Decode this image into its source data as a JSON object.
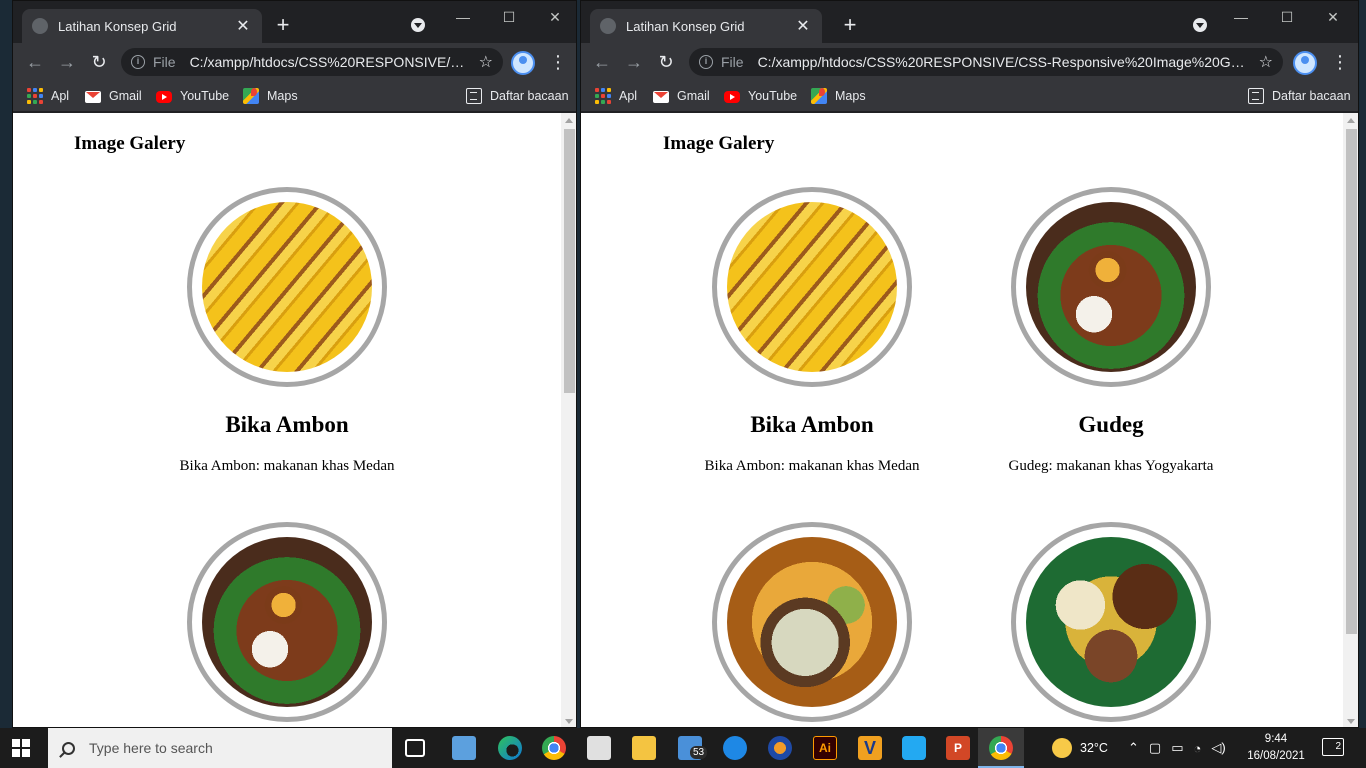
{
  "browser": {
    "tab_title": "Latihan Konsep Grid",
    "tab_close": "✕",
    "new_tab": "+",
    "scheme_label": "File",
    "window_controls": {
      "minimize": "—",
      "maximize": "☐",
      "close": "✕"
    }
  },
  "left_window": {
    "url": "C:/xampp/htdocs/CSS%20RESPONSIVE/C..."
  },
  "right_window": {
    "url": "C:/xampp/htdocs/CSS%20RESPONSIVE/CSS-Responsive%20Image%20Galler..."
  },
  "bookmarks": {
    "items": [
      {
        "label": "Apl",
        "icon": "apps-icon"
      },
      {
        "label": "Gmail",
        "icon": "gmail-icon"
      },
      {
        "label": "YouTube",
        "icon": "youtube-icon"
      },
      {
        "label": "Maps",
        "icon": "maps-icon"
      }
    ],
    "reading_list": "Daftar bacaan"
  },
  "page": {
    "heading": "Image Galery",
    "cards": [
      {
        "title": "Bika Ambon",
        "caption": "Bika Ambon: makanan khas Medan",
        "image": "bika-ambon-photo"
      },
      {
        "title": "Gudeg",
        "caption": "Gudeg: makanan khas Yogyakarta",
        "image": "gudeg-photo"
      },
      {
        "title": "",
        "caption": "",
        "image": "soup-photo"
      },
      {
        "title": "",
        "caption": "",
        "image": "mixed-dish-photo"
      }
    ]
  },
  "taskbar": {
    "search_placeholder": "Type here to search",
    "mail_badge": "53",
    "weather": "32°C",
    "time": "9:44",
    "date": "16/08/2021",
    "notifications": "2"
  },
  "colors": {
    "ring_border": "#a6a6a6",
    "browser_dark": "#202124",
    "toolbar": "#35363a"
  }
}
